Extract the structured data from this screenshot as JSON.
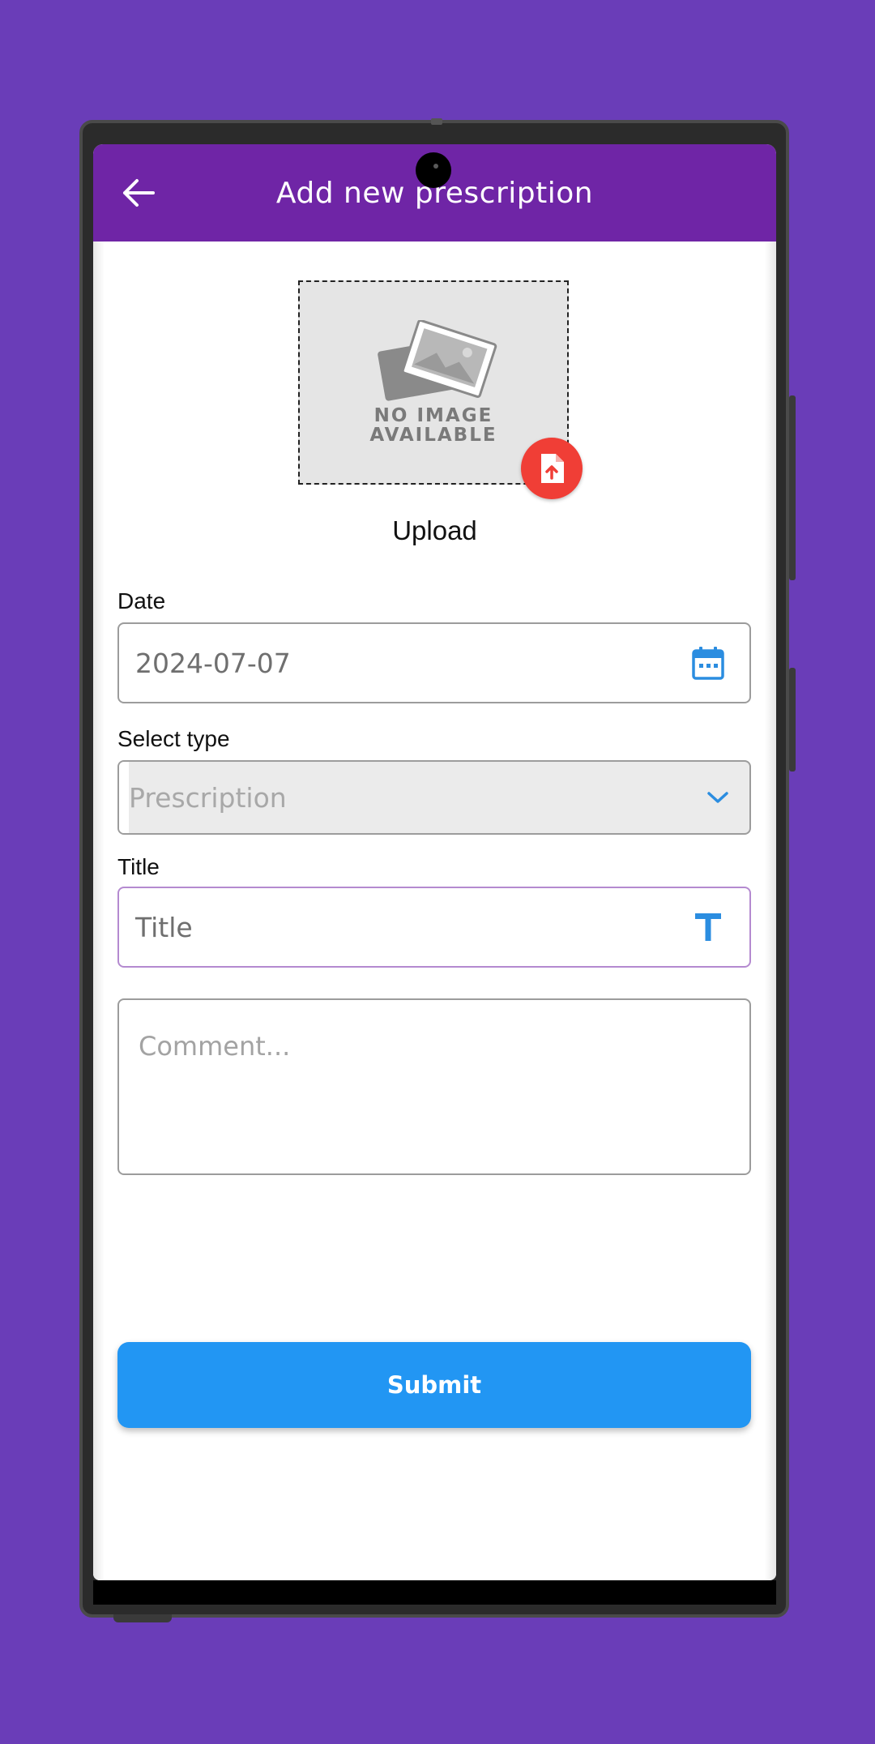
{
  "app": {
    "title": "Add new prescription"
  },
  "image_upload": {
    "placeholder_line1": "NO IMAGE",
    "placeholder_line2": "AVAILABLE",
    "upload_label": "Upload"
  },
  "form": {
    "date": {
      "label": "Date",
      "value": "2024-07-07"
    },
    "type": {
      "label": "Select type",
      "selected": "Prescription"
    },
    "title": {
      "label": "Title",
      "placeholder": "Title"
    },
    "comment": {
      "placeholder": "Comment..."
    },
    "submit_label": "Submit"
  },
  "colors": {
    "background": "#6a3db8",
    "appbar": "#6f25a6",
    "accent": "#2296f3",
    "upload_fab": "#f03e36"
  },
  "icons": {
    "back": "arrow-left-icon",
    "date": "calendar-icon",
    "type": "chevron-down-icon",
    "title": "text-t-icon",
    "upload": "file-upload-icon",
    "placeholder": "image-placeholder-icon"
  }
}
